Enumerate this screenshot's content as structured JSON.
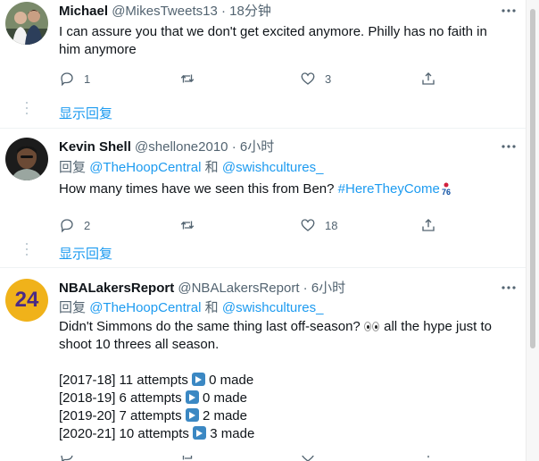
{
  "tweets": [
    {
      "name": "Michael",
      "handle": "@MikesTweets13",
      "sep": "·",
      "time": "18分钟",
      "text": "I can assure you that we don't get excited anymore. Philly has no faith in\nhim anymore",
      "reply_count": "1",
      "retweet_count": "",
      "like_count": "3",
      "show_replies": "显示回复"
    },
    {
      "name": "Kevin Shell",
      "handle": "@shellone2010",
      "sep": "·",
      "time": "6小时",
      "reply_prefix": "回复",
      "reply_user1": "@TheHoopCentral",
      "reply_and": "和",
      "reply_user2": "@swishcultures_",
      "text": "How many times have we seen this from Ben?",
      "hashtag": "#HereTheyCome",
      "reply_count": "2",
      "retweet_count": "",
      "like_count": "18",
      "show_replies": "显示回复"
    },
    {
      "name": "NBALakersReport",
      "handle": "@NBALakersReport",
      "sep": "·",
      "time": "6小时",
      "avatar_text": "24",
      "reply_prefix": "回复",
      "reply_user1": "@TheHoopCentral",
      "reply_and": "和",
      "reply_user2": "@swishcultures_",
      "text_line1": "Didn't Simmons do the same thing last off-season?",
      "text_line1b": "all the hype just to",
      "text_line2": "shoot 10 threes all season.",
      "stats": [
        {
          "season": "[2017-18] 11 attempts",
          "made": "0 made"
        },
        {
          "season": "[2018-19] 6 attempts",
          "made": "0 made"
        },
        {
          "season": "[2019-20] 7 attempts",
          "made": "2 made"
        },
        {
          "season": "[2020-21] 10 attempts",
          "made": "3 made"
        }
      ]
    }
  ],
  "colors": {
    "link": "#1d9bf0",
    "muted": "#536471",
    "text": "#0f1419"
  },
  "icons": [
    "reply-icon",
    "retweet-icon",
    "like-icon",
    "share-icon",
    "more-icon"
  ]
}
